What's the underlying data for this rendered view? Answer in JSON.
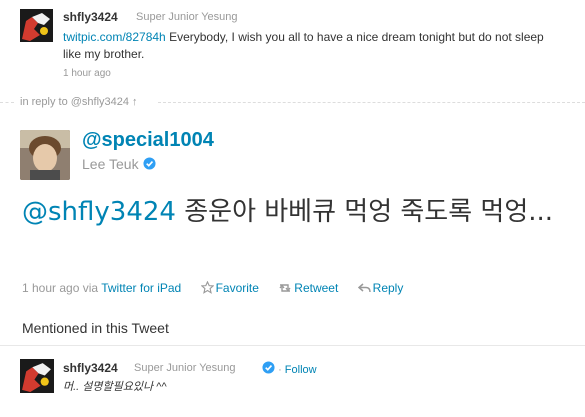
{
  "top_tweet": {
    "screen_name": "shfly3424",
    "full_name": "Super Junior Yesung",
    "link": "twitpic.com/82784h",
    "text": " Everybody, I wish you all to have a nice dream tonight but do not sleep like my brother.",
    "time": "1 hour ago"
  },
  "reply": {
    "label": "in reply to @shfly3424 ↑"
  },
  "main_tweet": {
    "handle": "@special1004",
    "full_name": "Lee Teuk",
    "mention": "@shfly3424",
    "text": " 종운아 바베큐 먹엉 죽도록 먹엉...",
    "time": "1 hour ago",
    "via": "via",
    "client": "Twitter for iPad",
    "favorite": "Favorite",
    "retweet": "Retweet",
    "reply": "Reply"
  },
  "mentioned": {
    "heading": "Mentioned in this Tweet",
    "user": {
      "screen_name": "shfly3424",
      "full_name": "Super Junior Yesung",
      "follow": "Follow",
      "bio": "머.. 설명할필요있나 ^^"
    }
  },
  "colors": {
    "link": "#0084b4",
    "muted": "#999999",
    "text": "#333333",
    "verified": "#2f9ff4"
  }
}
